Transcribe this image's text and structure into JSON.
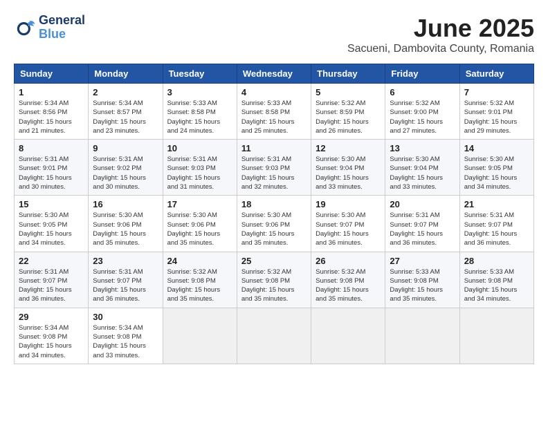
{
  "header": {
    "logo_line1": "General",
    "logo_line2": "Blue",
    "title": "June 2025",
    "subtitle": "Sacueni, Dambovita County, Romania"
  },
  "weekdays": [
    "Sunday",
    "Monday",
    "Tuesday",
    "Wednesday",
    "Thursday",
    "Friday",
    "Saturday"
  ],
  "weeks": [
    [
      {
        "day": 1,
        "sunrise": "5:34 AM",
        "sunset": "8:56 PM",
        "daylight": "15 hours and 21 minutes."
      },
      {
        "day": 2,
        "sunrise": "5:34 AM",
        "sunset": "8:57 PM",
        "daylight": "15 hours and 23 minutes."
      },
      {
        "day": 3,
        "sunrise": "5:33 AM",
        "sunset": "8:58 PM",
        "daylight": "15 hours and 24 minutes."
      },
      {
        "day": 4,
        "sunrise": "5:33 AM",
        "sunset": "8:58 PM",
        "daylight": "15 hours and 25 minutes."
      },
      {
        "day": 5,
        "sunrise": "5:32 AM",
        "sunset": "8:59 PM",
        "daylight": "15 hours and 26 minutes."
      },
      {
        "day": 6,
        "sunrise": "5:32 AM",
        "sunset": "9:00 PM",
        "daylight": "15 hours and 27 minutes."
      },
      {
        "day": 7,
        "sunrise": "5:32 AM",
        "sunset": "9:01 PM",
        "daylight": "15 hours and 29 minutes."
      }
    ],
    [
      {
        "day": 8,
        "sunrise": "5:31 AM",
        "sunset": "9:01 PM",
        "daylight": "15 hours and 30 minutes."
      },
      {
        "day": 9,
        "sunrise": "5:31 AM",
        "sunset": "9:02 PM",
        "daylight": "15 hours and 30 minutes."
      },
      {
        "day": 10,
        "sunrise": "5:31 AM",
        "sunset": "9:03 PM",
        "daylight": "15 hours and 31 minutes."
      },
      {
        "day": 11,
        "sunrise": "5:31 AM",
        "sunset": "9:03 PM",
        "daylight": "15 hours and 32 minutes."
      },
      {
        "day": 12,
        "sunrise": "5:30 AM",
        "sunset": "9:04 PM",
        "daylight": "15 hours and 33 minutes."
      },
      {
        "day": 13,
        "sunrise": "5:30 AM",
        "sunset": "9:04 PM",
        "daylight": "15 hours and 33 minutes."
      },
      {
        "day": 14,
        "sunrise": "5:30 AM",
        "sunset": "9:05 PM",
        "daylight": "15 hours and 34 minutes."
      }
    ],
    [
      {
        "day": 15,
        "sunrise": "5:30 AM",
        "sunset": "9:05 PM",
        "daylight": "15 hours and 34 minutes."
      },
      {
        "day": 16,
        "sunrise": "5:30 AM",
        "sunset": "9:06 PM",
        "daylight": "15 hours and 35 minutes."
      },
      {
        "day": 17,
        "sunrise": "5:30 AM",
        "sunset": "9:06 PM",
        "daylight": "15 hours and 35 minutes."
      },
      {
        "day": 18,
        "sunrise": "5:30 AM",
        "sunset": "9:06 PM",
        "daylight": "15 hours and 35 minutes."
      },
      {
        "day": 19,
        "sunrise": "5:30 AM",
        "sunset": "9:07 PM",
        "daylight": "15 hours and 36 minutes."
      },
      {
        "day": 20,
        "sunrise": "5:31 AM",
        "sunset": "9:07 PM",
        "daylight": "15 hours and 36 minutes."
      },
      {
        "day": 21,
        "sunrise": "5:31 AM",
        "sunset": "9:07 PM",
        "daylight": "15 hours and 36 minutes."
      }
    ],
    [
      {
        "day": 22,
        "sunrise": "5:31 AM",
        "sunset": "9:07 PM",
        "daylight": "15 hours and 36 minutes."
      },
      {
        "day": 23,
        "sunrise": "5:31 AM",
        "sunset": "9:07 PM",
        "daylight": "15 hours and 36 minutes."
      },
      {
        "day": 24,
        "sunrise": "5:32 AM",
        "sunset": "9:08 PM",
        "daylight": "15 hours and 35 minutes."
      },
      {
        "day": 25,
        "sunrise": "5:32 AM",
        "sunset": "9:08 PM",
        "daylight": "15 hours and 35 minutes."
      },
      {
        "day": 26,
        "sunrise": "5:32 AM",
        "sunset": "9:08 PM",
        "daylight": "15 hours and 35 minutes."
      },
      {
        "day": 27,
        "sunrise": "5:33 AM",
        "sunset": "9:08 PM",
        "daylight": "15 hours and 35 minutes."
      },
      {
        "day": 28,
        "sunrise": "5:33 AM",
        "sunset": "9:08 PM",
        "daylight": "15 hours and 34 minutes."
      }
    ],
    [
      {
        "day": 29,
        "sunrise": "5:34 AM",
        "sunset": "9:08 PM",
        "daylight": "15 hours and 34 minutes."
      },
      {
        "day": 30,
        "sunrise": "5:34 AM",
        "sunset": "9:08 PM",
        "daylight": "15 hours and 33 minutes."
      },
      null,
      null,
      null,
      null,
      null
    ]
  ]
}
